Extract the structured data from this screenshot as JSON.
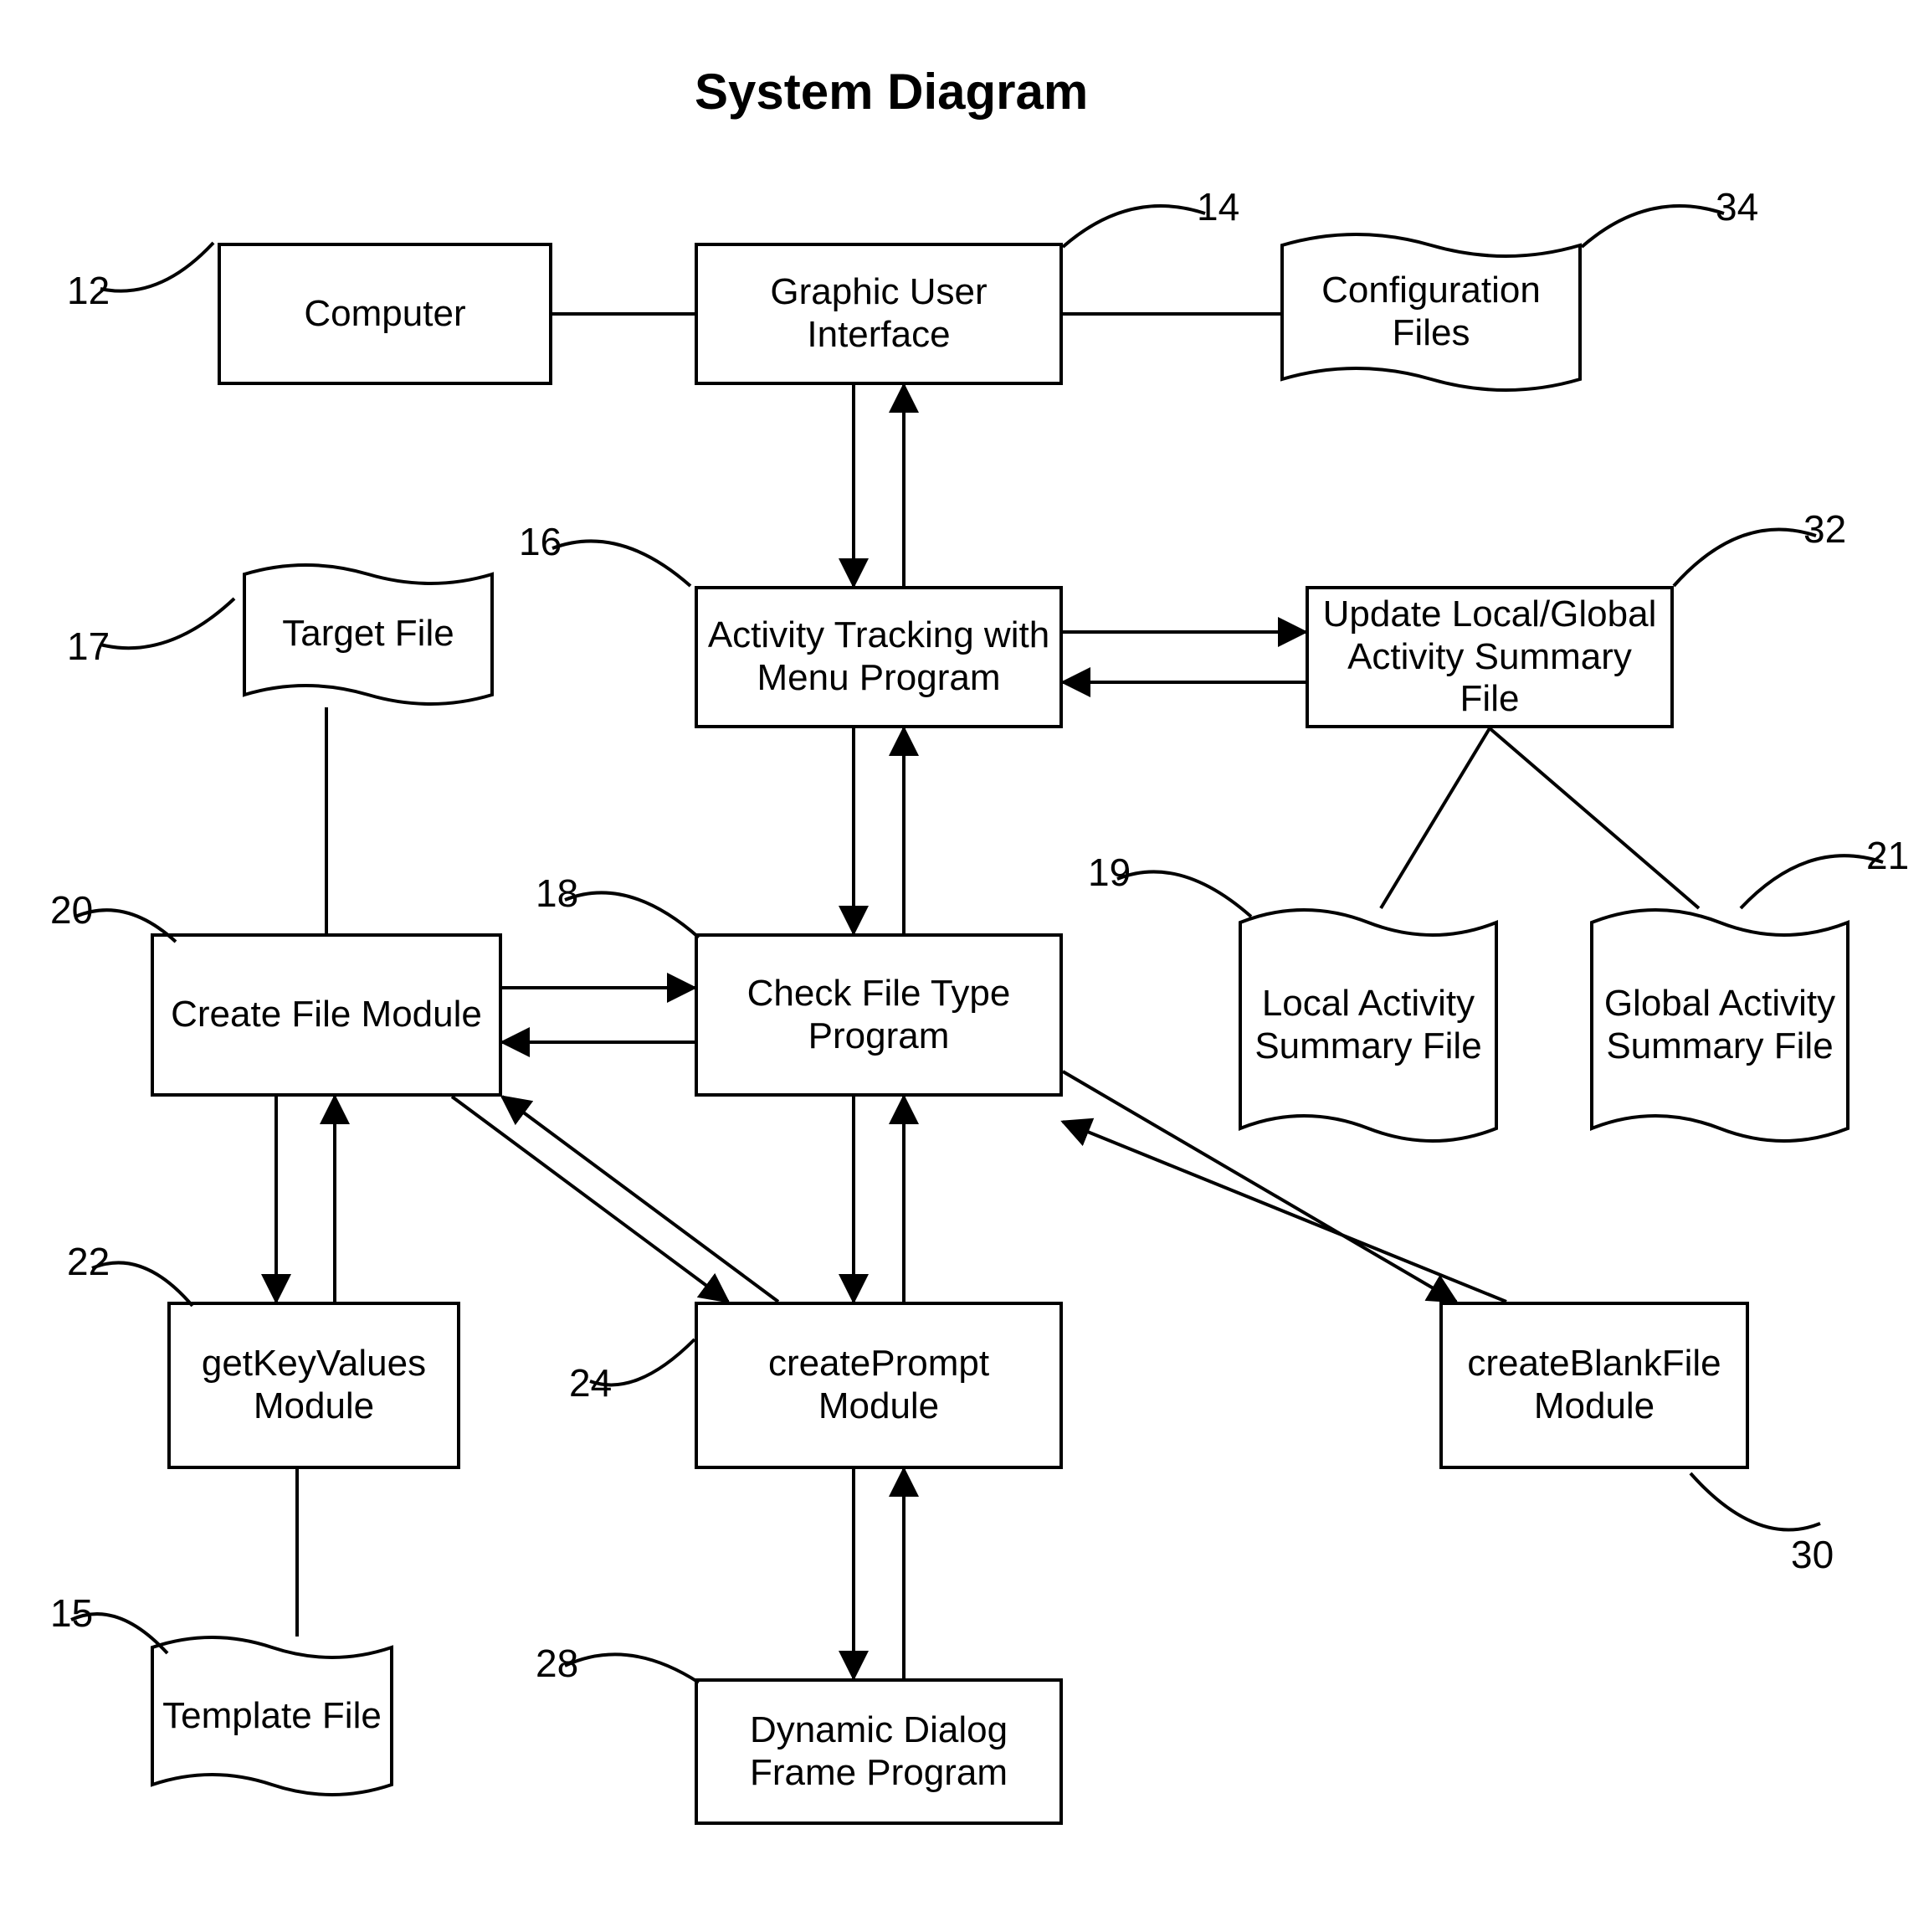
{
  "title": "System Diagram",
  "boxes": {
    "computer": "Computer",
    "gui": "Graphic User Interface",
    "config": "Configuration Files",
    "target": "Target File",
    "activity": "Activity Tracking with Menu Program",
    "update": "Update Local/Global Activity Summary File",
    "createFile": "Create File Module",
    "checkFile": "Check File Type Program",
    "localSummary": "Local Activity Summary File",
    "globalSummary": "Global Activity Summary File",
    "getKey": "getKeyValues Module",
    "createPrompt": "createPrompt Module",
    "createBlank": "createBlankFile Module",
    "template": "Template File",
    "dynDialog": "Dynamic Dialog Frame Program"
  },
  "refs": {
    "r12": "12",
    "r14": "14",
    "r15": "15",
    "r16": "16",
    "r17": "17",
    "r18": "18",
    "r19": "19",
    "r20": "20",
    "r21": "21",
    "r22": "22",
    "r24": "24",
    "r28": "28",
    "r30": "30",
    "r32": "32",
    "r34": "34"
  }
}
